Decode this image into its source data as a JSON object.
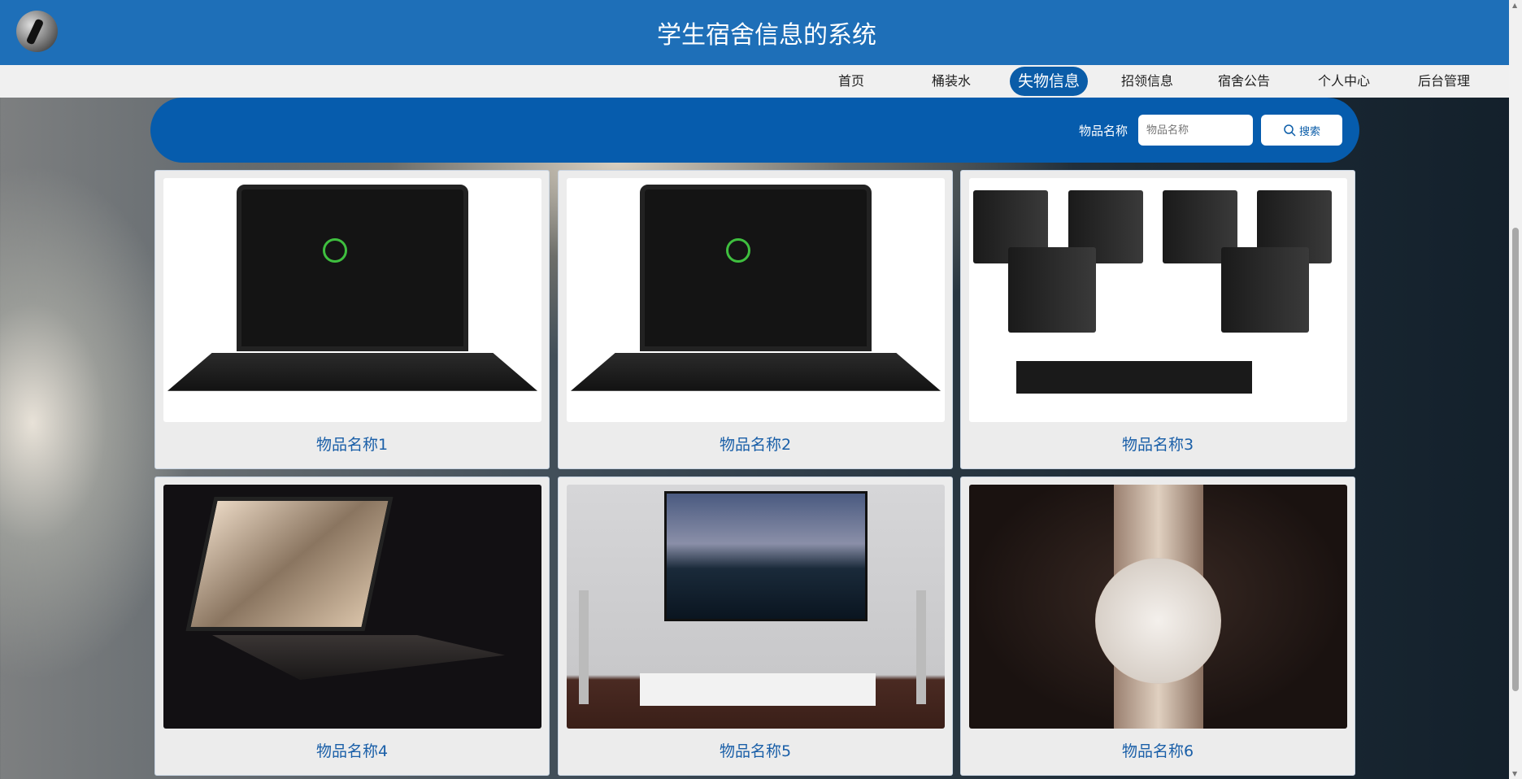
{
  "header": {
    "title": "学生宿舍信息的系统"
  },
  "nav": {
    "items": [
      "首页",
      "桶装水",
      "失物信息",
      "招领信息",
      "宿舍公告",
      "个人中心",
      "后台管理"
    ],
    "active": "失物信息"
  },
  "search": {
    "label": "物品名称",
    "placeholder": "物品名称",
    "button": "搜索"
  },
  "items": [
    {
      "name": "物品名称1"
    },
    {
      "name": "物品名称2"
    },
    {
      "name": "物品名称3"
    },
    {
      "name": "物品名称4"
    },
    {
      "name": "物品名称5"
    },
    {
      "name": "物品名称6"
    }
  ],
  "colors": {
    "header": "#1e6fb8",
    "accent": "#0a5ca8",
    "caption": "#1a5fa8"
  }
}
